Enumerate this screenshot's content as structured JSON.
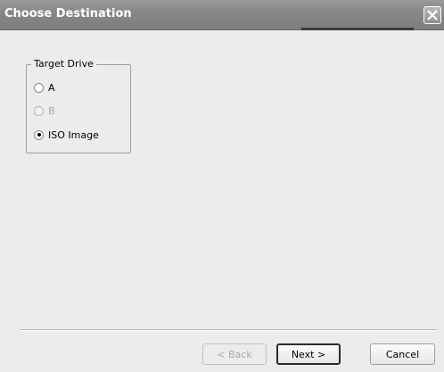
{
  "window": {
    "title": "Choose Destination"
  },
  "target_drive": {
    "legend": "Target Drive",
    "options": [
      {
        "label": "A",
        "checked": false,
        "enabled": true
      },
      {
        "label": "B",
        "checked": false,
        "enabled": false
      },
      {
        "label": "ISO Image",
        "checked": true,
        "enabled": true
      }
    ]
  },
  "buttons": {
    "back": "< Back",
    "next": "Next >",
    "cancel": "Cancel"
  },
  "icons": {
    "close": "close-icon"
  }
}
